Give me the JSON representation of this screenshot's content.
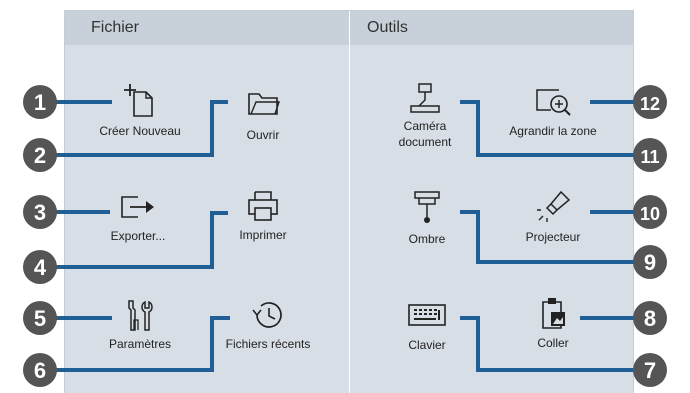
{
  "sections": {
    "file_title": "Fichier",
    "tools_title": "Outils"
  },
  "items": {
    "new": "Créer Nouveau",
    "open": "Ouvrir",
    "export": "Exporter...",
    "print": "Imprimer",
    "settings": "Paramètres",
    "recent": "Fichiers récents",
    "camera_line1": "Caméra",
    "camera_line2": "document",
    "zoom": "Agrandir la zone",
    "shade": "Ombre",
    "projector": "Projecteur",
    "keyboard": "Clavier",
    "paste": "Coller"
  },
  "callouts": [
    "1",
    "2",
    "3",
    "4",
    "5",
    "6",
    "7",
    "8",
    "9",
    "10",
    "11",
    "12"
  ],
  "colors": {
    "panel": "#d8dee6",
    "header": "#c8d0da",
    "callout": "#555555",
    "line": "#1f5f95"
  }
}
